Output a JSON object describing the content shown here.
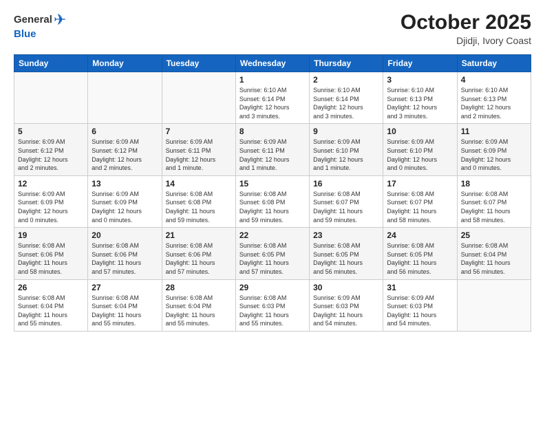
{
  "header": {
    "logo_general": "General",
    "logo_blue": "Blue",
    "month": "October 2025",
    "location": "Djidji, Ivory Coast"
  },
  "columns": [
    "Sunday",
    "Monday",
    "Tuesday",
    "Wednesday",
    "Thursday",
    "Friday",
    "Saturday"
  ],
  "weeks": [
    [
      {
        "day": "",
        "info": ""
      },
      {
        "day": "",
        "info": ""
      },
      {
        "day": "",
        "info": ""
      },
      {
        "day": "1",
        "info": "Sunrise: 6:10 AM\nSunset: 6:14 PM\nDaylight: 12 hours\nand 3 minutes."
      },
      {
        "day": "2",
        "info": "Sunrise: 6:10 AM\nSunset: 6:14 PM\nDaylight: 12 hours\nand 3 minutes."
      },
      {
        "day": "3",
        "info": "Sunrise: 6:10 AM\nSunset: 6:13 PM\nDaylight: 12 hours\nand 3 minutes."
      },
      {
        "day": "4",
        "info": "Sunrise: 6:10 AM\nSunset: 6:13 PM\nDaylight: 12 hours\nand 2 minutes."
      }
    ],
    [
      {
        "day": "5",
        "info": "Sunrise: 6:09 AM\nSunset: 6:12 PM\nDaylight: 12 hours\nand 2 minutes."
      },
      {
        "day": "6",
        "info": "Sunrise: 6:09 AM\nSunset: 6:12 PM\nDaylight: 12 hours\nand 2 minutes."
      },
      {
        "day": "7",
        "info": "Sunrise: 6:09 AM\nSunset: 6:11 PM\nDaylight: 12 hours\nand 1 minute."
      },
      {
        "day": "8",
        "info": "Sunrise: 6:09 AM\nSunset: 6:11 PM\nDaylight: 12 hours\nand 1 minute."
      },
      {
        "day": "9",
        "info": "Sunrise: 6:09 AM\nSunset: 6:10 PM\nDaylight: 12 hours\nand 1 minute."
      },
      {
        "day": "10",
        "info": "Sunrise: 6:09 AM\nSunset: 6:10 PM\nDaylight: 12 hours\nand 0 minutes."
      },
      {
        "day": "11",
        "info": "Sunrise: 6:09 AM\nSunset: 6:09 PM\nDaylight: 12 hours\nand 0 minutes."
      }
    ],
    [
      {
        "day": "12",
        "info": "Sunrise: 6:09 AM\nSunset: 6:09 PM\nDaylight: 12 hours\nand 0 minutes."
      },
      {
        "day": "13",
        "info": "Sunrise: 6:09 AM\nSunset: 6:09 PM\nDaylight: 12 hours\nand 0 minutes."
      },
      {
        "day": "14",
        "info": "Sunrise: 6:08 AM\nSunset: 6:08 PM\nDaylight: 11 hours\nand 59 minutes."
      },
      {
        "day": "15",
        "info": "Sunrise: 6:08 AM\nSunset: 6:08 PM\nDaylight: 11 hours\nand 59 minutes."
      },
      {
        "day": "16",
        "info": "Sunrise: 6:08 AM\nSunset: 6:07 PM\nDaylight: 11 hours\nand 59 minutes."
      },
      {
        "day": "17",
        "info": "Sunrise: 6:08 AM\nSunset: 6:07 PM\nDaylight: 11 hours\nand 58 minutes."
      },
      {
        "day": "18",
        "info": "Sunrise: 6:08 AM\nSunset: 6:07 PM\nDaylight: 11 hours\nand 58 minutes."
      }
    ],
    [
      {
        "day": "19",
        "info": "Sunrise: 6:08 AM\nSunset: 6:06 PM\nDaylight: 11 hours\nand 58 minutes."
      },
      {
        "day": "20",
        "info": "Sunrise: 6:08 AM\nSunset: 6:06 PM\nDaylight: 11 hours\nand 57 minutes."
      },
      {
        "day": "21",
        "info": "Sunrise: 6:08 AM\nSunset: 6:06 PM\nDaylight: 11 hours\nand 57 minutes."
      },
      {
        "day": "22",
        "info": "Sunrise: 6:08 AM\nSunset: 6:05 PM\nDaylight: 11 hours\nand 57 minutes."
      },
      {
        "day": "23",
        "info": "Sunrise: 6:08 AM\nSunset: 6:05 PM\nDaylight: 11 hours\nand 56 minutes."
      },
      {
        "day": "24",
        "info": "Sunrise: 6:08 AM\nSunset: 6:05 PM\nDaylight: 11 hours\nand 56 minutes."
      },
      {
        "day": "25",
        "info": "Sunrise: 6:08 AM\nSunset: 6:04 PM\nDaylight: 11 hours\nand 56 minutes."
      }
    ],
    [
      {
        "day": "26",
        "info": "Sunrise: 6:08 AM\nSunset: 6:04 PM\nDaylight: 11 hours\nand 55 minutes."
      },
      {
        "day": "27",
        "info": "Sunrise: 6:08 AM\nSunset: 6:04 PM\nDaylight: 11 hours\nand 55 minutes."
      },
      {
        "day": "28",
        "info": "Sunrise: 6:08 AM\nSunset: 6:04 PM\nDaylight: 11 hours\nand 55 minutes."
      },
      {
        "day": "29",
        "info": "Sunrise: 6:08 AM\nSunset: 6:03 PM\nDaylight: 11 hours\nand 55 minutes."
      },
      {
        "day": "30",
        "info": "Sunrise: 6:09 AM\nSunset: 6:03 PM\nDaylight: 11 hours\nand 54 minutes."
      },
      {
        "day": "31",
        "info": "Sunrise: 6:09 AM\nSunset: 6:03 PM\nDaylight: 11 hours\nand 54 minutes."
      },
      {
        "day": "",
        "info": ""
      }
    ]
  ]
}
